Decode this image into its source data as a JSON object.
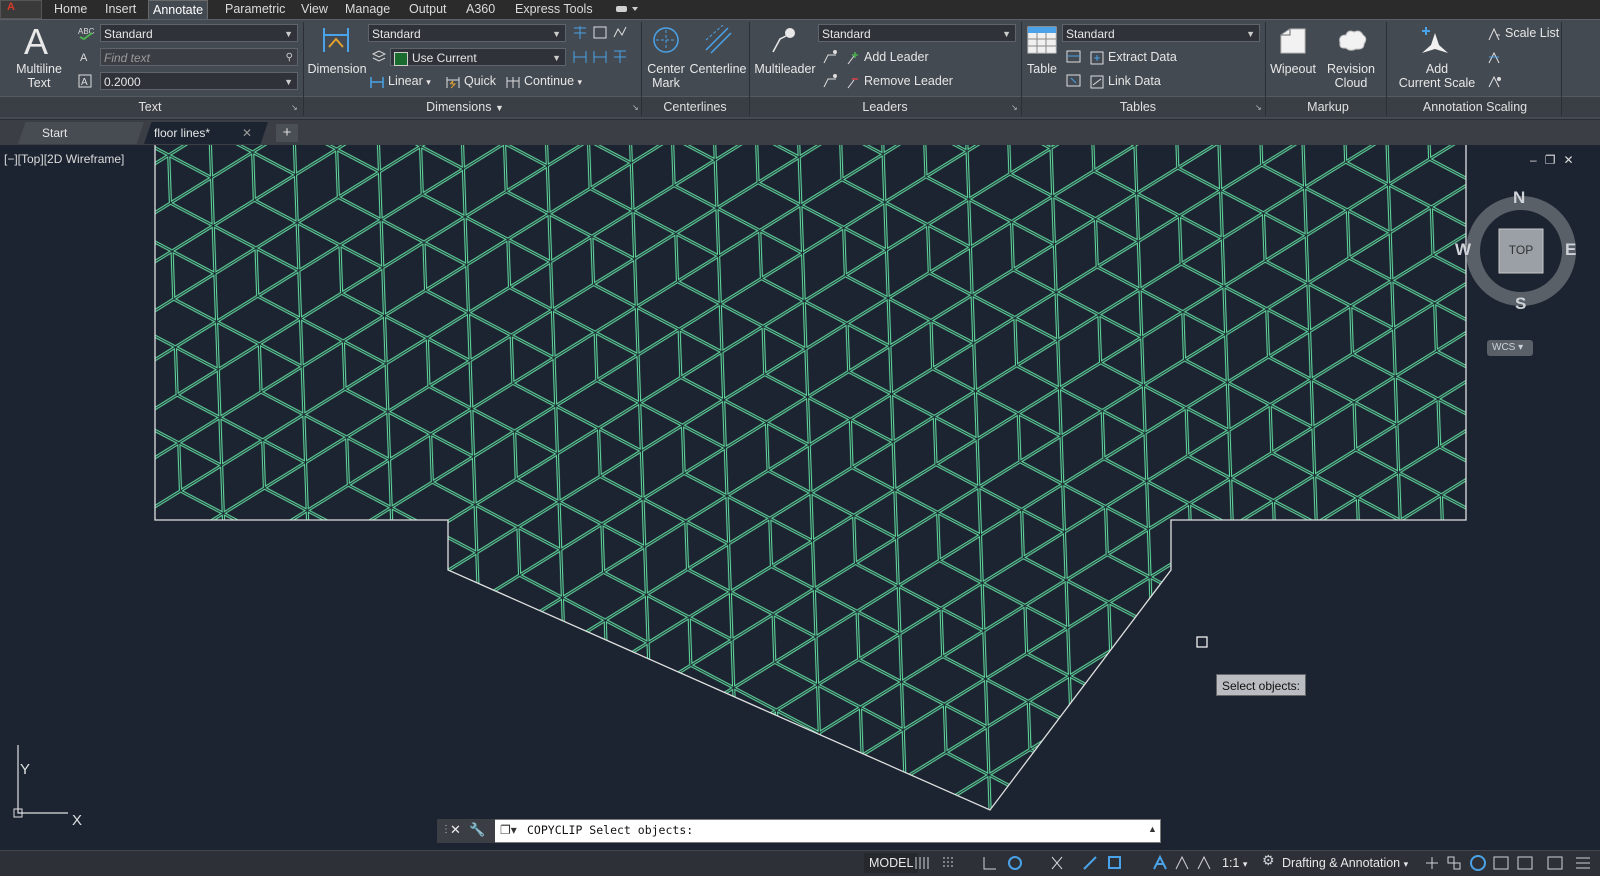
{
  "ribbon_tabs": [
    "Home",
    "Insert",
    "Annotate",
    "Parametric",
    "View",
    "Manage",
    "Output",
    "A360",
    "Express Tools"
  ],
  "active_tab": "Annotate",
  "text_panel": {
    "big_button": "Multiline\nText",
    "style_value": "Standard",
    "find_placeholder": "Find text",
    "height_value": "0.2000",
    "title": "Text"
  },
  "dimensions_panel": {
    "big_button": "Dimension",
    "style_value": "Standard",
    "layer_value": "Use Current",
    "linear": "Linear",
    "quick": "Quick",
    "continue": "Continue",
    "title": "Dimensions"
  },
  "centerlines_panel": {
    "center_mark": "Center\nMark",
    "centerline": "Centerline",
    "title": "Centerlines"
  },
  "leaders_panel": {
    "big_button": "Multileader",
    "style_value": "Standard",
    "add": "Add Leader",
    "remove": "Remove Leader",
    "title": "Leaders"
  },
  "tables_panel": {
    "big_button": "Table",
    "style_value": "Standard",
    "extract": "Extract Data",
    "link": "Link Data",
    "title": "Tables"
  },
  "markup_panel": {
    "wipeout": "Wipeout",
    "revision": "Revision\nCloud",
    "title": "Markup"
  },
  "annotation_scaling_panel": {
    "add_scale": "Add\nCurrent Scale",
    "scale_list": "Scale List",
    "title": "Annotation Scaling"
  },
  "doc_tabs": [
    "Start",
    "floor lines*"
  ],
  "active_doc": "floor lines*",
  "viewport_label": "[−][Top][2D Wireframe]",
  "viewcube": {
    "n": "N",
    "s": "S",
    "e": "E",
    "w": "W",
    "face": "TOP",
    "wcs": "WCS"
  },
  "ucs": {
    "x": "X",
    "y": "Y"
  },
  "tooltip": "Select objects:",
  "command_line": "COPYCLIP Select objects:",
  "status": {
    "model": "MODEL",
    "scale": "1:1",
    "workspace": "Drafting & Annotation"
  },
  "colors": {
    "lines": "#5fd39a",
    "boundary": "#e0e0e0",
    "background": "#1b2430"
  }
}
